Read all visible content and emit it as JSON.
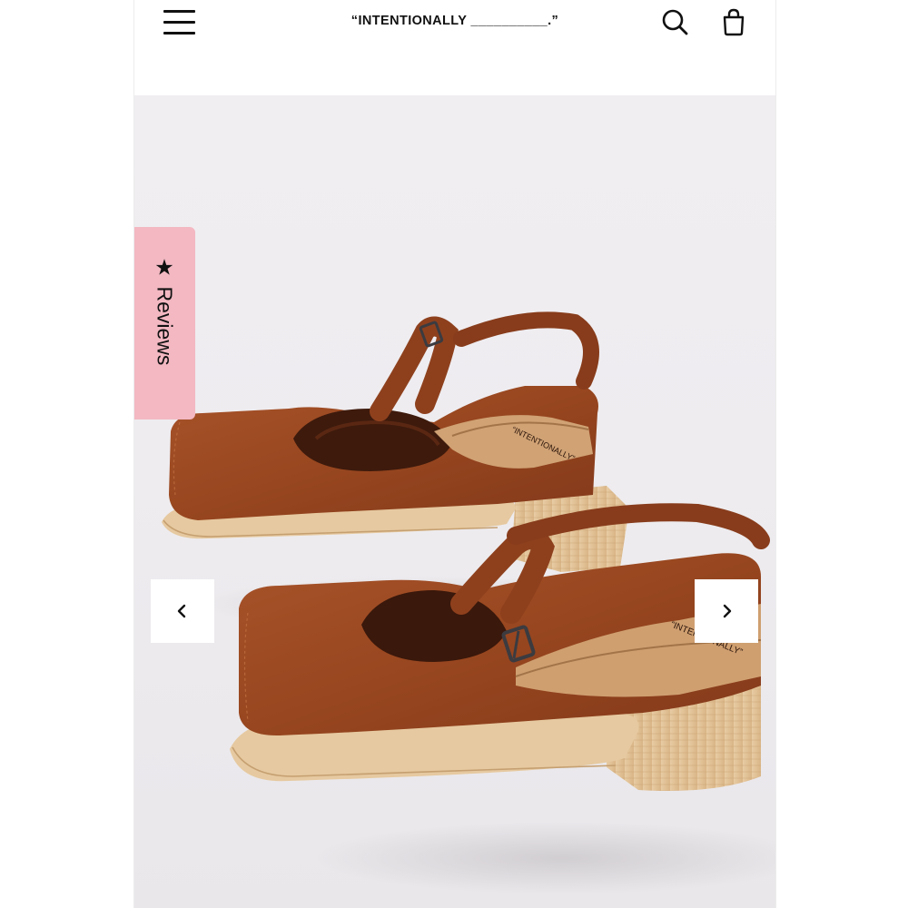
{
  "header": {
    "menu_icon": "hamburger-menu-icon",
    "brand": "“INTENTIONALLY __________.”",
    "search_icon": "search-icon",
    "bag_icon": "shopping-bag-icon"
  },
  "gallery": {
    "reviews_tab": {
      "icon": "star-icon",
      "star": "★",
      "label": "Reviews",
      "color": "#f3b8c2"
    },
    "prev_icon": "chevron-left-icon",
    "prev": "‹",
    "next_icon": "chevron-right-icon",
    "next": "›",
    "product_image": {
      "insole_text": "“INTENTIONALLY”",
      "leather_color": "#9a4a24",
      "heel_color": "#e3c49a"
    }
  }
}
